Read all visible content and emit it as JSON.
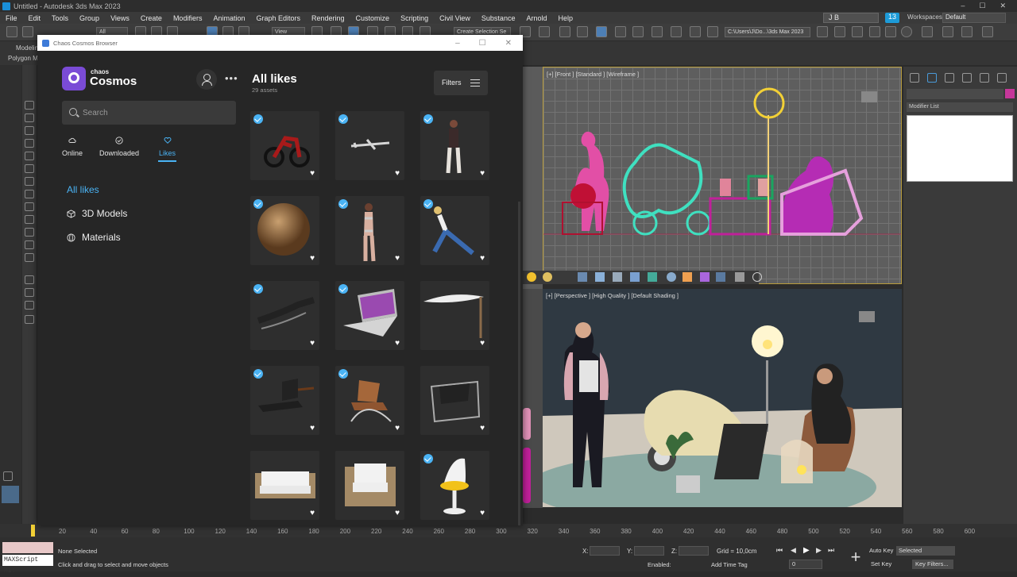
{
  "window": {
    "title": "Untitled - Autodesk 3ds Max 2023",
    "controls": [
      "–",
      "☐",
      "✕"
    ]
  },
  "menu": {
    "items": [
      "File",
      "Edit",
      "Tools",
      "Group",
      "Views",
      "Create",
      "Modifiers",
      "Animation",
      "Graph Editors",
      "Rendering",
      "Customize",
      "Scripting",
      "Civil View",
      "Substance",
      "Arnold",
      "Help"
    ],
    "user": "J B",
    "badge": "13",
    "workspaces_label": "Workspaces:",
    "workspace": "Default"
  },
  "toolbar": {
    "filter": "All",
    "view": "View",
    "selection_set": "Create Selection Se",
    "path": "C:\\Users\\J\\Do...\\3ds Max 2023"
  },
  "ribbon": {
    "tab1": "Modeling",
    "tab2": "Polygon Modeling"
  },
  "viewports": {
    "front_label": "[+] [Front ] [Standard ] [Wireframe ]",
    "persp_label": "[+] [Perspective ] [High Quality ] [Default Shading ]"
  },
  "command_panel": {
    "modifier_list": "Modifier List"
  },
  "timeline": {
    "ticks": [
      "20",
      "40",
      "60",
      "80",
      "100",
      "120",
      "140",
      "160",
      "180",
      "200",
      "220",
      "240",
      "260",
      "280",
      "300",
      "320",
      "340",
      "360",
      "380",
      "400",
      "420",
      "440",
      "460",
      "480",
      "500",
      "520",
      "540",
      "560",
      "580",
      "600"
    ]
  },
  "statusbar": {
    "maxscript": "MAXScript Mi:",
    "selection": "None Selected",
    "hint": "Click and drag to select and move objects",
    "x": "X:",
    "y": "Y:",
    "z": "Z:",
    "grid": "Grid = 10,0cm",
    "enabled": "Enabled:",
    "add_time_tag": "Add Time Tag",
    "auto_key": "Auto Key",
    "set_key": "Set Key",
    "selected": "Selected",
    "key_filters": "Key Filters...",
    "frame": "0"
  },
  "cosmos": {
    "window_title": "Chaos Cosmos Browser",
    "brand_small": "chaos",
    "brand_big": "Cosmos",
    "search_placeholder": "Search",
    "tabs": [
      "Online",
      "Downloaded",
      "Likes"
    ],
    "nav": [
      "All likes",
      "3D Models",
      "Materials"
    ],
    "main_title": "All likes",
    "asset_count": "29 assets",
    "filters_label": "Filters",
    "assets": [
      {
        "name": "motorbike",
        "checked": true
      },
      {
        "name": "airplane",
        "checked": true
      },
      {
        "name": "woman-standing",
        "checked": true
      },
      {
        "name": "wood-sphere",
        "checked": true
      },
      {
        "name": "woman-swimsuit",
        "checked": true
      },
      {
        "name": "woman-stretching",
        "checked": true
      },
      {
        "name": "chaise-lounge",
        "checked": true
      },
      {
        "name": "laptop",
        "checked": true
      },
      {
        "name": "parasol",
        "checked": false
      },
      {
        "name": "lounge-chair",
        "checked": true
      },
      {
        "name": "barcelona-chair",
        "checked": true
      },
      {
        "name": "wassily-chair",
        "checked": false
      },
      {
        "name": "wicker-sofa",
        "checked": false
      },
      {
        "name": "wicker-armchair",
        "checked": false
      },
      {
        "name": "tulip-chair",
        "checked": true
      }
    ]
  },
  "colors": {
    "accent": "#4ab3f4",
    "cosmos_purple": "#7a4bd6",
    "viewport_border": "#b89c3c",
    "wire_pink": "#e24fa6",
    "wire_teal": "#3fe0c0",
    "wire_magenta": "#c0209a",
    "wire_red": "#b01030"
  }
}
